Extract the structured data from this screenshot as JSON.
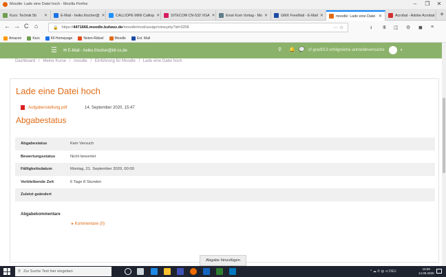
{
  "window": {
    "title": "Moodle: Lade eine Datei hoch - Mozilla Firefox",
    "controls": [
      "–",
      "❐",
      "✕"
    ]
  },
  "tabs": [
    {
      "label": "Kurs: Technik 5b",
      "color": "#6f9e4f"
    },
    {
      "label": "E-Mail - heiko.frischer@",
      "color": "#1a73e8"
    },
    {
      "label": "CALLIOPE MINI Calliop",
      "color": "#1e90ff"
    },
    {
      "label": "SITECOM CN-532 VGA",
      "color": "#d81b60"
    },
    {
      "label": "Einst Kom Vortag - Mo",
      "color": "#607d8b"
    },
    {
      "label": "GMX FreeMail - E-Mail",
      "color": "#1c4aa5"
    },
    {
      "label": "moodle: Lade eine Datei",
      "color": "#e06b16",
      "active": true
    },
    {
      "label": "Acrobat - Adobe Acrobat",
      "color": "#d32f2f"
    }
  ],
  "new_tab": "+",
  "nav": {
    "back": "←",
    "forward": "→",
    "reload": "C",
    "home": "⌂",
    "url_prefix": "https://",
    "url_domain": "4471666.moodle.bulwuz.de",
    "url_path": "/moodle/mod/assign/view.php?id=3258",
    "url_tools": "··· ☆",
    "right_icons": [
      "⭳",
      "Ⅲ",
      "◫",
      "⚙",
      "◼",
      "≡"
    ]
  },
  "bookmarks": [
    {
      "label": "Amazon",
      "color": "#ff9900"
    },
    {
      "label": "Kurs",
      "color": "#6f9e4f"
    },
    {
      "label": "Kll-Homepage",
      "color": "#1a73e8"
    },
    {
      "label": "Noten-Rätsel",
      "color": "#e64a19"
    },
    {
      "label": "Moodle",
      "color": "#e06b16"
    },
    {
      "label": "Ext. Mail",
      "color": "#1c4aa5"
    }
  ],
  "moodle_header": {
    "menu_icon": "☰",
    "mail_line": "✉ E-Mail - heiko.frischer@kll-cs.de",
    "search_icon": "⚲",
    "bell_icon": "🔔",
    "chat_icon": "💬",
    "user_name": "cf-grad013 erfolgreiche anmeldeversuche",
    "user_caret": "▾"
  },
  "breadcrumb": [
    "Dashboard",
    "/",
    "Meine Kurse",
    "/",
    "moodle",
    "/",
    "Einführung für Moodle",
    "/",
    "Lade eine Datei hoch"
  ],
  "page": {
    "title": "Lade eine Datei hoch",
    "file_label": "Aufgabenstellung.pdf",
    "file_date": "14. September 2020, 15:47",
    "section_title": "Abgabestatus",
    "status_rows": [
      {
        "label": "Abgabestatus",
        "value": "Kein Versuch"
      },
      {
        "label": "Bewertungsstatus",
        "value": "Nicht bewertet"
      },
      {
        "label": "Fälligkeitsdatum",
        "value": "Montag, 21. September 2020, 00:00"
      },
      {
        "label": "Verbleibende Zeit",
        "value": "6 Tage 8 Stunden"
      },
      {
        "label": "Zuletzt geändert",
        "value": ""
      }
    ],
    "comments_label": "Abgabekommentare",
    "comments_link": "▸ Kommentare (0)",
    "submit_button": "Abgabe hinzufügen"
  },
  "taskbar": {
    "search_placeholder": "Zur Suche Text hier eingeben",
    "search_icon": "⚲",
    "apps": [
      {
        "name": "cortana",
        "color": "#ffffff",
        "shape": "circle"
      },
      {
        "name": "task-view",
        "color": "#cfd8dc"
      },
      {
        "name": "edge",
        "color": "#1e88e5"
      },
      {
        "name": "explorer",
        "color": "#fbc02d"
      },
      {
        "name": "store",
        "color": "#3f51b5"
      },
      {
        "name": "firefox",
        "color": "#ef6c00"
      },
      {
        "name": "word",
        "color": "#1565c0"
      },
      {
        "name": "excel",
        "color": "#2e7d32"
      },
      {
        "name": "outlook",
        "color": "#0277bd"
      }
    ],
    "tray": "^ ☁ ✆ ◍ ⊲ DEU",
    "clock_time": "15:59",
    "clock_date": "14.09.2020"
  }
}
